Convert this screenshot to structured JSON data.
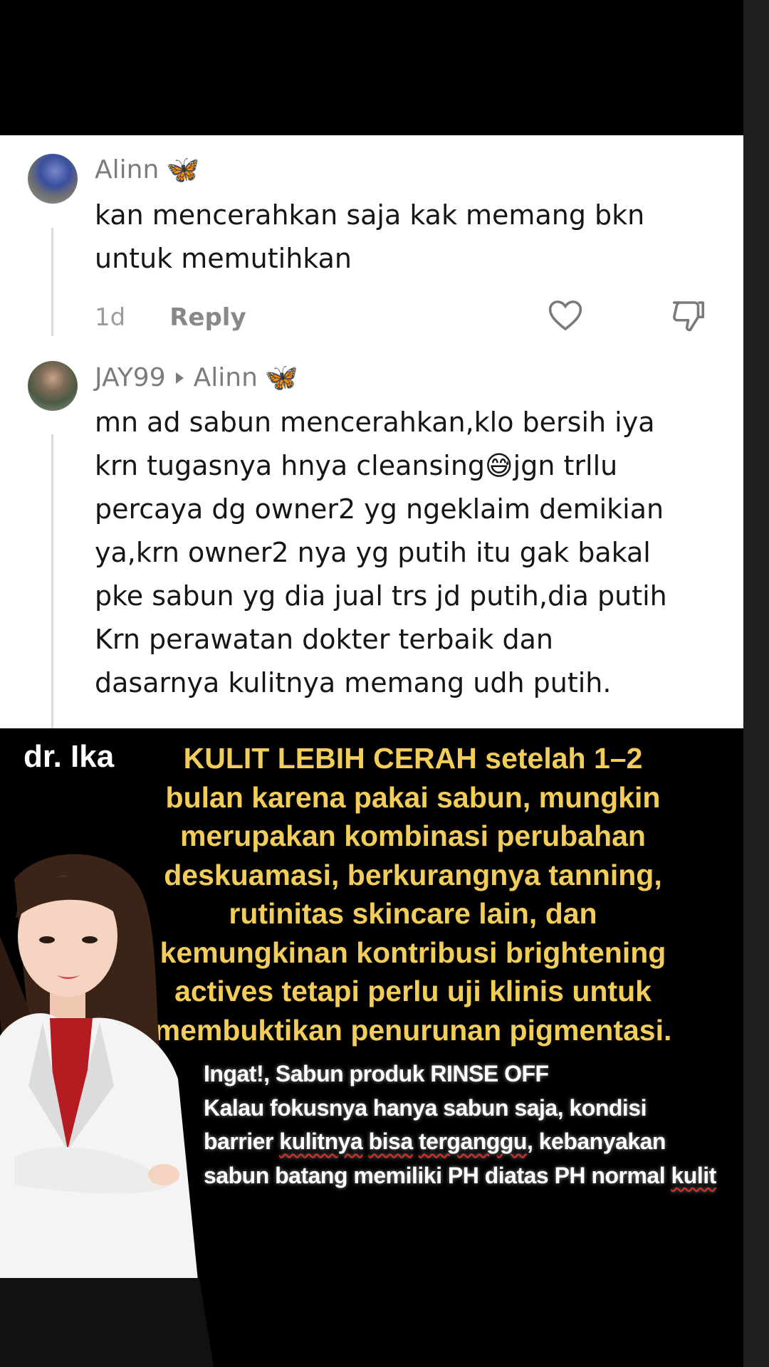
{
  "comments": [
    {
      "username": "Alinn",
      "body_lines": [
        "kan mencerahkan saja kak memang bkn",
        "untuk memutihkan"
      ],
      "time": "1d",
      "reply_label": "Reply"
    },
    {
      "username": "JAY99",
      "reply_to": "Alinn",
      "body_lines": [
        "mn ad sabun mencerahkan,klo bersih iya",
        "krn tugasnya hnya cleansing",
        "percaya dg owner2 yg ngeklaim demikian",
        "ya,krn owner2 nya yg putih itu gak bakal",
        "pke sabun yg dia jual trs jd putih,dia putih",
        "Krn perawatan dokter terbaik dan",
        "dasarnya kulitnya memang udh putih."
      ],
      "body_line2_after_emoji": "jgn trllu",
      "emoji": "😅"
    }
  ],
  "overlay": {
    "doctor_name": "dr. Ika",
    "headline_lines": [
      "KULIT LEBIH CERAH setelah 1–2",
      "bulan karena  pakai sabun, mungkin",
      "merupakan kombinasi perubahan",
      "deskuamasi, berkurangnya tanning,",
      "rutinitas skincare lain, dan",
      "kemungkinan kontribusi brightening",
      "actives tetapi perlu uji klinis untuk",
      "membuktikan penurunan pigmentasi."
    ],
    "note_line1": "Ingat!, Sabun produk RINSE OFF",
    "note_line2": "Kalau fokusnya hanya sabun saja, kondisi",
    "note_line3_a": "barrier ",
    "note_line3_b": "kulitnya",
    "note_line3_c": " ",
    "note_line3_d": "bisa",
    "note_line3_e": " ",
    "note_line3_f": "terganggu",
    "note_line3_g": ", kebanyakan",
    "note_line4_a": "sabun batang memiliki PH diatas PH normal ",
    "note_line4_b": "kulit"
  },
  "colors": {
    "headline": "#f2cd5a",
    "card_bg": "#ffffff",
    "username": "#7c7c7c",
    "butterfly": "#3f8fe6"
  },
  "icons": [
    "butterfly-emoji",
    "heart-icon",
    "dislike-icon",
    "reply-triangle-icon"
  ]
}
